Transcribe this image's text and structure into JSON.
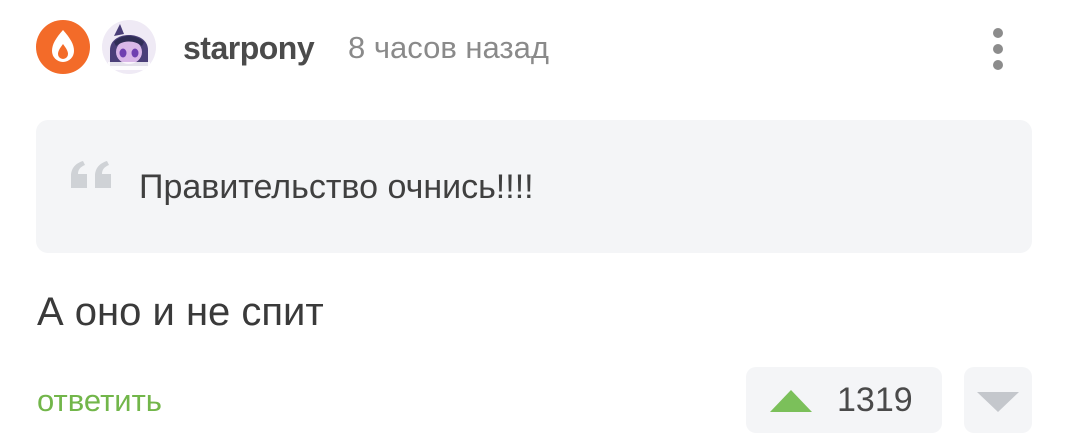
{
  "comment": {
    "author": "starpony",
    "timestamp": "8 часов назад",
    "quote": "Правительство очнись!!!!",
    "text": "А оно и не спит",
    "reply_label": "ответить",
    "rating": "1319"
  },
  "colors": {
    "badge": "#f36b29",
    "upvote": "#7bc05a",
    "downvote": "#c4c7cc",
    "reply": "#72b64a",
    "quote_bg": "#f4f5f7"
  },
  "icons": {
    "badge": "fire-badge-icon",
    "menu": "more-vertical-icon",
    "quote": "quote-icon",
    "upvote": "arrow-up-icon",
    "downvote": "arrow-down-icon"
  }
}
